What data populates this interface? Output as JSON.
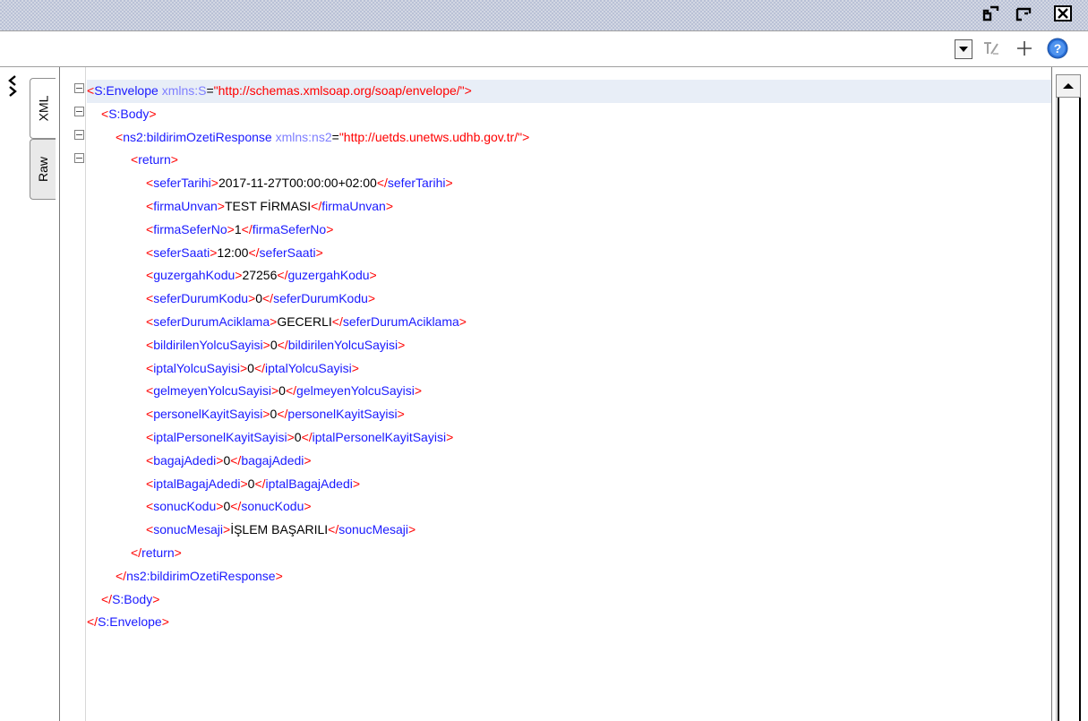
{
  "tabs": {
    "xml": "XML",
    "raw": "Raw"
  },
  "icons": {
    "restore": "restore-icon",
    "popout": "popout-icon",
    "close": "close-icon",
    "dropdown": "dropdown-icon",
    "format": "format-icon",
    "add": "plus-icon",
    "help": "help-icon",
    "collapse": "collapse-panel-icon",
    "scroll_up": "scroll-up-icon"
  },
  "colors": {
    "tag": "#1a1aff",
    "punctuation": "#ff0000",
    "attribute": "#7f7fff",
    "string": "#ff0000",
    "text": "#000000",
    "highlight_line": "#e8eef7"
  },
  "xml": {
    "envelope_open": {
      "tag": "S:Envelope",
      "attr": "xmlns:S",
      "value": "\"http://schemas.xmlsoap.org/soap/envelope/\""
    },
    "body_open": "S:Body",
    "response_open": {
      "tag": "ns2:bildirimOzetiResponse",
      "attr": "xmlns:ns2",
      "value": "\"http://uetds.unetws.udhb.gov.tr/\""
    },
    "return_open": "return",
    "fields": [
      {
        "name": "seferTarihi",
        "value": "2017-11-27T00:00:00+02:00"
      },
      {
        "name": "firmaUnvan",
        "value": "TEST FİRMASI"
      },
      {
        "name": "firmaSeferNo",
        "value": "1"
      },
      {
        "name": "seferSaati",
        "value": "12:00"
      },
      {
        "name": "guzergahKodu",
        "value": "27256"
      },
      {
        "name": "seferDurumKodu",
        "value": "0"
      },
      {
        "name": "seferDurumAciklama",
        "value": "GECERLI"
      },
      {
        "name": "bildirilenYolcuSayisi",
        "value": "0"
      },
      {
        "name": "iptalYolcuSayisi",
        "value": "0"
      },
      {
        "name": "gelmeyenYolcuSayisi",
        "value": "0"
      },
      {
        "name": "personelKayitSayisi",
        "value": "0"
      },
      {
        "name": "iptalPersonelKayitSayisi",
        "value": "0"
      },
      {
        "name": "bagajAdedi",
        "value": "0"
      },
      {
        "name": "iptalBagajAdedi",
        "value": "0"
      },
      {
        "name": "sonucKodu",
        "value": "0"
      },
      {
        "name": "sonucMesaji",
        "value": "İŞLEM BAŞARILI"
      }
    ],
    "return_close": "return",
    "response_close": "ns2:bildirimOzetiResponse",
    "body_close": "S:Body",
    "envelope_close": "S:Envelope"
  }
}
